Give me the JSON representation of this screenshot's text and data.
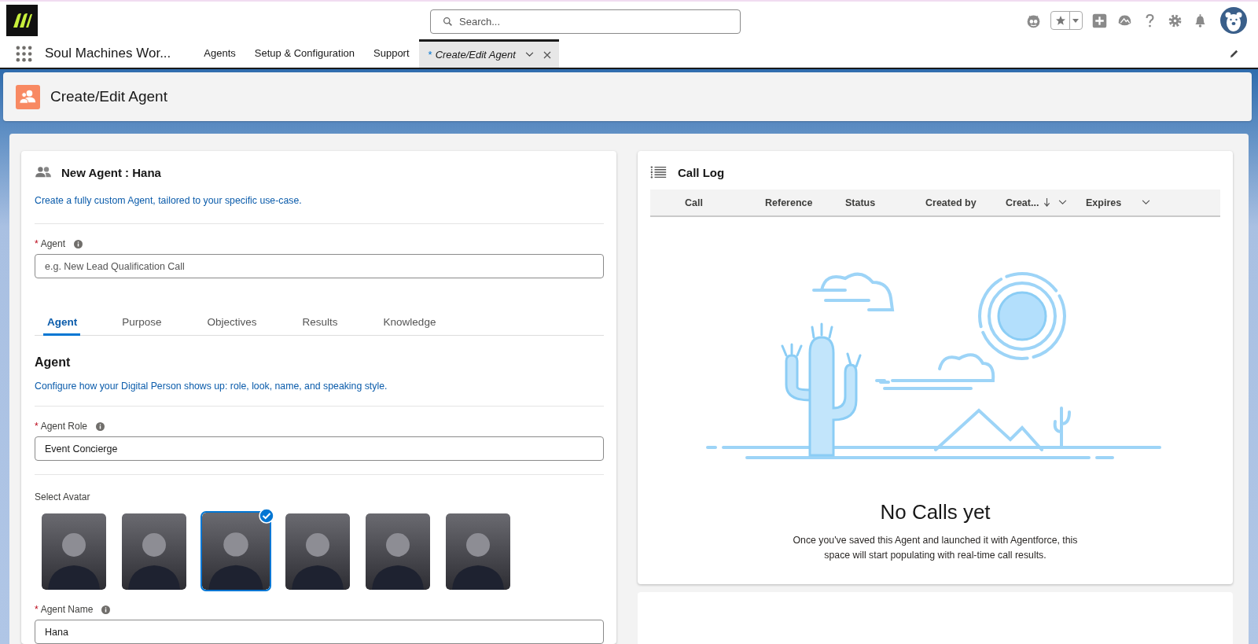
{
  "header": {
    "search": {
      "placeholder": "Search..."
    }
  },
  "nav": {
    "app_name": "Soul Machines Wor...",
    "items": [
      {
        "label": "Agents",
        "selected": false
      },
      {
        "label": "Setup & Configuration",
        "selected": false
      },
      {
        "label": "Support",
        "selected": false
      }
    ],
    "open_tab": {
      "marker": "*",
      "label": "Create/Edit Agent",
      "selected": true
    }
  },
  "page_header": {
    "title": "Create/Edit Agent"
  },
  "agent_card": {
    "title": "New Agent : Hana",
    "subtitle": "Create a fully custom Agent, tailored to your specific use-case.",
    "agent_field": {
      "required_mark": "*",
      "label": "Agent",
      "placeholder": "e.g. New Lead Qualification Call"
    },
    "tabs": [
      {
        "label": "Agent",
        "selected": true
      },
      {
        "label": "Purpose",
        "selected": false
      },
      {
        "label": "Objectives",
        "selected": false
      },
      {
        "label": "Results",
        "selected": false
      },
      {
        "label": "Knowledge",
        "selected": false
      }
    ],
    "section": {
      "title": "Agent",
      "description": "Configure how your Digital Person shows up: role, look, name, and speaking style."
    },
    "role_field": {
      "required_mark": "*",
      "label": "Agent Role",
      "value": "Event Concierge"
    },
    "avatar_label": "Select Avatar",
    "avatars": [
      {
        "selected": false
      },
      {
        "selected": false
      },
      {
        "selected": true
      },
      {
        "selected": false
      },
      {
        "selected": false
      },
      {
        "selected": false
      }
    ],
    "name_field": {
      "required_mark": "*",
      "label": "Agent Name",
      "value": "Hana"
    }
  },
  "call_log": {
    "title": "Call Log",
    "columns": [
      {
        "label": "Call",
        "sorted": false,
        "menu": false
      },
      {
        "label": "Reference",
        "sorted": false,
        "menu": false
      },
      {
        "label": "Status",
        "sorted": false,
        "menu": false
      },
      {
        "label": "Created by",
        "sorted": false,
        "menu": false
      },
      {
        "label": "Creat...",
        "sorted": true,
        "menu": true
      },
      {
        "label": "Expires",
        "sorted": false,
        "menu": true
      }
    ],
    "empty": {
      "title": "No Calls yet",
      "message": "Once you've saved this Agent and launched it with Agentforce, this space will start populating with real-time call results."
    }
  }
}
